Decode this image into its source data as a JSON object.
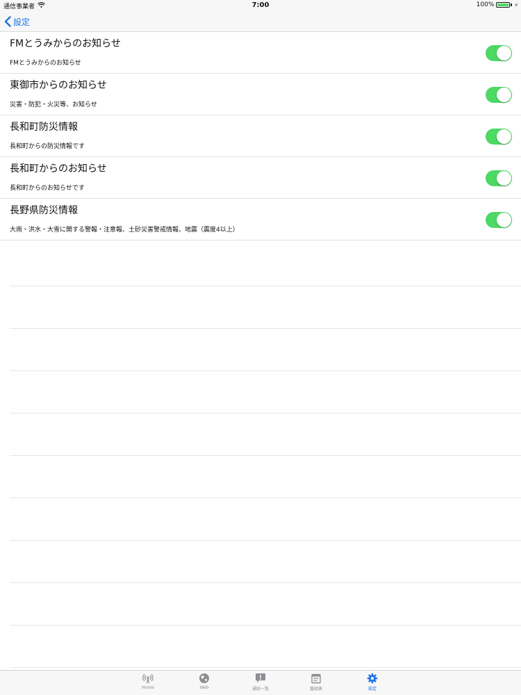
{
  "status": {
    "carrier": "通信事業者",
    "time": "7:00",
    "battery": "100%",
    "battery_level": 1.0
  },
  "nav": {
    "back_label": "設定"
  },
  "settings": [
    {
      "title": "FMとうみからのお知らせ",
      "subtitle": "FMとうみからのお知らせ",
      "enabled": true
    },
    {
      "title": "東御市からのお知らせ",
      "subtitle": "災害・防犯・火災等、お知らせ",
      "enabled": true
    },
    {
      "title": "長和町防災情報",
      "subtitle": "長和町からの防災情報です",
      "enabled": true
    },
    {
      "title": "長和町からのお知らせ",
      "subtitle": "長和町からのお知らせです",
      "enabled": true
    },
    {
      "title": "長野県防災情報",
      "subtitle": "大雨・洪水・大雪に関する警報・注意報、土砂災害警戒情報、地震（震度4以上）",
      "enabled": true
    }
  ],
  "tabs": [
    {
      "label": "Home",
      "icon": "broadcast-icon"
    },
    {
      "label": "Web",
      "icon": "globe-icon"
    },
    {
      "label": "通知一覧",
      "icon": "alert-icon"
    },
    {
      "label": "番組表",
      "icon": "schedule-icon"
    },
    {
      "label": "設定",
      "icon": "gear-icon",
      "active": true
    }
  ],
  "colors": {
    "accent": "#1a73e8",
    "toggle_on": "#4cd964",
    "tab_inactive": "#8e8e93"
  }
}
